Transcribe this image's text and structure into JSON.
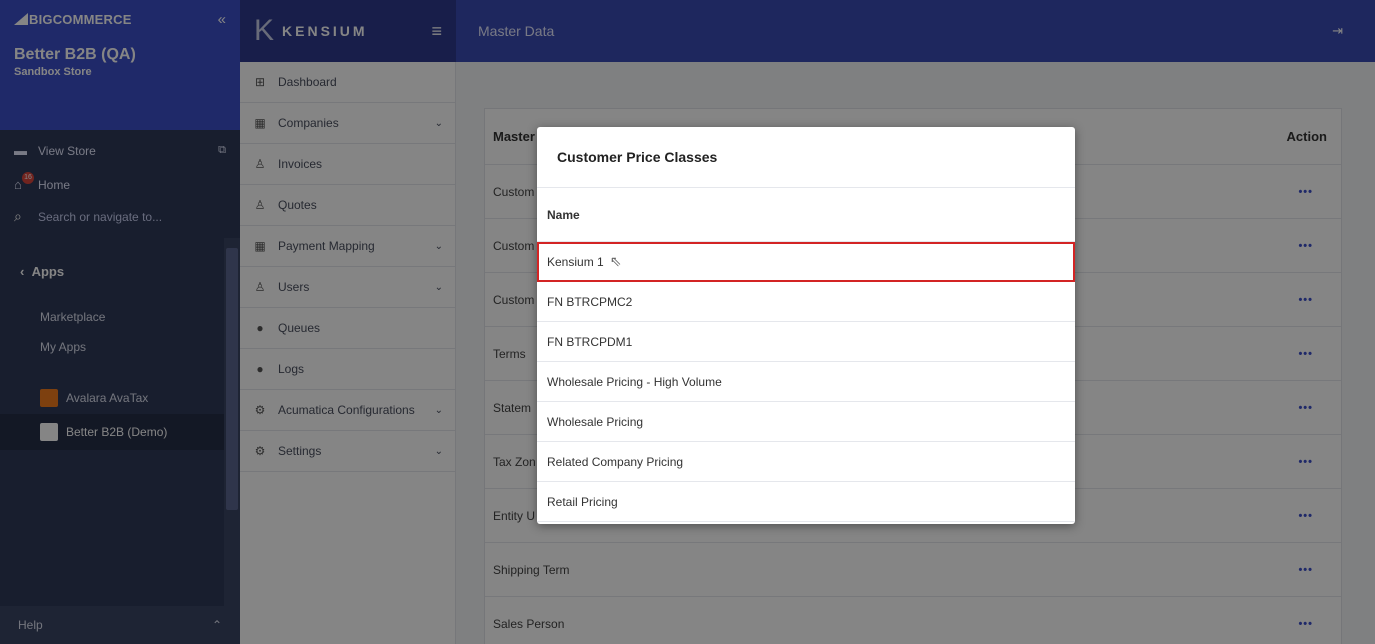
{
  "bc": {
    "logo": "BIGCOMMERCE",
    "collapse_icon": "«",
    "store_name": "Better B2B (QA)",
    "store_sub": "Sandbox Store",
    "view_store": "View Store",
    "home": "Home",
    "home_badge": "16",
    "search_placeholder": "Search or navigate to...",
    "apps": "Apps",
    "marketplace": "Marketplace",
    "my_apps": "My Apps",
    "app_avalara": "Avalara AvaTax",
    "app_betterb2b": "Better B2B (Demo)",
    "help": "Help"
  },
  "header": {
    "brand": "KENSIUM",
    "title": "Master Data"
  },
  "nav": [
    {
      "label": "Dashboard",
      "icon": "dashboard-icon",
      "glyph": "⊞",
      "chevron": false
    },
    {
      "label": "Companies",
      "icon": "building-icon",
      "glyph": "▦",
      "chevron": true
    },
    {
      "label": "Invoices",
      "icon": "user-icon",
      "glyph": "♙",
      "chevron": false
    },
    {
      "label": "Quotes",
      "icon": "user-icon",
      "glyph": "♙",
      "chevron": false
    },
    {
      "label": "Payment Mapping",
      "icon": "building-icon",
      "glyph": "▦",
      "chevron": true
    },
    {
      "label": "Users",
      "icon": "user-icon",
      "glyph": "♙",
      "chevron": true
    },
    {
      "label": "Queues",
      "icon": "github-icon",
      "glyph": "●",
      "chevron": false
    },
    {
      "label": "Logs",
      "icon": "github-icon",
      "glyph": "●",
      "chevron": false
    },
    {
      "label": "Acumatica Configurations",
      "icon": "gear-icon",
      "glyph": "⚙",
      "chevron": true
    },
    {
      "label": "Settings",
      "icon": "gear-icon",
      "glyph": "⚙",
      "chevron": true
    }
  ],
  "table": {
    "col_master": "Master",
    "col_action": "Action",
    "rows": [
      "Custom",
      "Custom",
      "Custom",
      "Terms",
      "Statem",
      "Tax Zon",
      "Entity U",
      "Shipping Term",
      "Sales Person"
    ],
    "action_glyph": "•••"
  },
  "modal": {
    "title": "Customer Price Classes",
    "column": "Name",
    "rows": [
      "Kensium 1",
      "FN BTRCPMC2",
      "FN BTRCPDM1",
      "Wholesale Pricing - High Volume",
      "Wholesale Pricing",
      "Related Company Pricing",
      "Retail Pricing"
    ]
  },
  "colors": {
    "bc_blue": "#3d4fc9",
    "bc_dark": "#2f3a59",
    "kensium_header": "#3b4bb5",
    "selection_outline": "#d32424"
  }
}
